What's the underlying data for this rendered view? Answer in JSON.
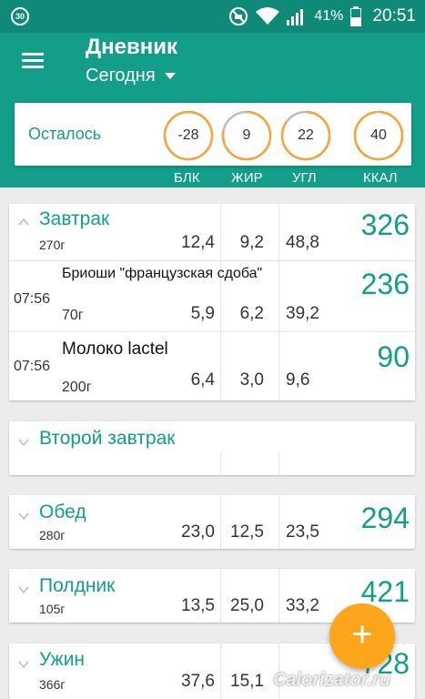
{
  "status_bar": {
    "notification_badge": "30",
    "battery_percent": "41%",
    "time": "20:51"
  },
  "header": {
    "title": "Дневник",
    "date_selector": "Сегодня"
  },
  "summary": {
    "label": "Осталось",
    "protein": "-28",
    "fat": "9",
    "carbs": "22",
    "kcal": "40",
    "macro_labels": {
      "protein": "БЛК",
      "fat": "ЖИР",
      "carbs": "УГЛ",
      "kcal": "ККАЛ"
    }
  },
  "meals": {
    "breakfast": {
      "name": "Завтрак",
      "weight": "270г",
      "protein": "12,4",
      "fat": "9,2",
      "carbs": "48,8",
      "kcal": "326",
      "items": [
        {
          "time": "07:56",
          "name": "Бриоши \"французская сдоба\"",
          "weight": "70г",
          "protein": "5,9",
          "fat": "6,2",
          "carbs": "39,2",
          "kcal": "236"
        },
        {
          "time": "07:56",
          "name": "Молоко lactel",
          "weight": "200г",
          "protein": "6,4",
          "fat": "3,0",
          "carbs": "9,6",
          "kcal": "90"
        }
      ]
    },
    "second_breakfast": {
      "name": "Второй завтрак"
    },
    "lunch": {
      "name": "Обед",
      "weight": "280г",
      "protein": "23,0",
      "fat": "12,5",
      "carbs": "23,5",
      "kcal": "294"
    },
    "snack": {
      "name": "Полдник",
      "weight": "105г",
      "protein": "13,5",
      "fat": "25,0",
      "carbs": "33,2",
      "kcal": "421"
    },
    "dinner": {
      "name": "Ужин",
      "weight": "366г",
      "protein": "37,6",
      "fat": "15,1",
      "carbs": "",
      "kcal": "728"
    }
  },
  "fab": {
    "label": "+"
  },
  "watermark": "Calorizator.ru",
  "colors": {
    "status_bar": "#0f8a78",
    "primary": "#139e89",
    "accent_orange": "#f5a53a",
    "fab": "#fda61c",
    "ring_track": "#bdbdbd"
  },
  "icons": [
    "menu-icon",
    "dropdown-arrow-icon",
    "dnd-icon",
    "wifi-icon",
    "signal-icon",
    "battery-icon",
    "chevron-up-icon",
    "chevron-down-icon",
    "plus-icon"
  ],
  "progress": {
    "protein": 1.0,
    "fat": 0.78,
    "carbs": 0.85,
    "kcal": 0.98
  }
}
